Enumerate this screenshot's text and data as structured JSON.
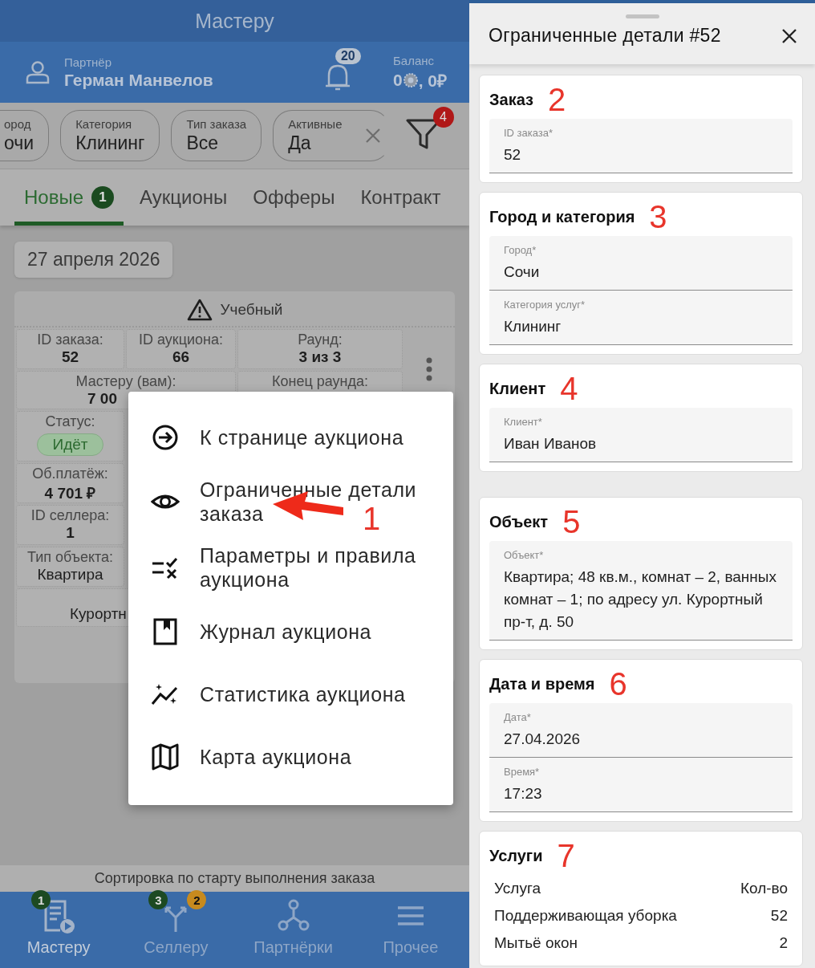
{
  "left_screen": {
    "title": "Мастеру",
    "partner": {
      "label": "Партнёр",
      "name": "Герман Манвелов"
    },
    "notifications": {
      "count": "20"
    },
    "balance": {
      "label": "Баланс",
      "coins": "0",
      "rubles": ", 0₽"
    },
    "filters": [
      {
        "label": "ород",
        "value": "очи",
        "clearable": false
      },
      {
        "label": "Категория",
        "value": "Клининг",
        "clearable": false
      },
      {
        "label": "Тип заказа",
        "value": "Все",
        "clearable": false
      },
      {
        "label": "Активные",
        "value": "Да",
        "clearable": true
      }
    ],
    "filter_button": {
      "badge": "4"
    },
    "tabs": [
      {
        "label": "Новые",
        "badge": "1",
        "selected": true
      },
      {
        "label": "Аукционы",
        "selected": false
      },
      {
        "label": "Офферы",
        "selected": false
      },
      {
        "label": "Контракт",
        "selected": false
      }
    ],
    "date": "27 апреля 2026",
    "card": {
      "banner": "Учебный",
      "fields": [
        {
          "kind": "plain",
          "label": "ID заказа:",
          "value": "52"
        },
        {
          "kind": "plain",
          "label": "ID аукциона:",
          "value": "66"
        },
        {
          "kind": "plain",
          "label": "Раунд:",
          "value": "3 из 3"
        },
        {
          "kind": "plain",
          "label": "Мастеру (вам):",
          "value": "7 00"
        },
        {
          "label": "Конец раунда:"
        },
        {
          "kind": "status",
          "label": "Статус:",
          "value": "Идёт"
        },
        {
          "kind": "plain",
          "label": "Об.платёж:",
          "value": "4 701 ₽"
        },
        {
          "kind": "plain",
          "label": "ID селлера:",
          "value": "1"
        },
        {
          "kind": "light",
          "label": "Тип объекта:",
          "value": "Квартира"
        },
        {
          "kind": "light",
          "value": "Курортн"
        }
      ]
    },
    "menu": [
      {
        "label": "К странице аукциона"
      },
      {
        "label": "Ограниченные детали заказа",
        "annotation": "1"
      },
      {
        "label": "Параметры и правила аукциона"
      },
      {
        "label": "Журнал аукциона"
      },
      {
        "label": "Статистика аукциона"
      },
      {
        "label": "Карта аукциона"
      }
    ],
    "sort_label": "Сортировка по старту выполнения заказа",
    "bottom_nav": [
      {
        "label": "Мастеру",
        "selected": true,
        "badges": [
          {
            "text": "1",
            "color": "#1d4a22"
          }
        ]
      },
      {
        "label": "Селлеру",
        "selected": false,
        "badges": [
          {
            "text": "3",
            "color": "#1d4a22"
          },
          {
            "text": "2",
            "color": "#c78a1e"
          }
        ]
      },
      {
        "label": "Партнёрки",
        "selected": false
      },
      {
        "label": "Прочее",
        "selected": false
      }
    ]
  },
  "details_sheet": {
    "title": "Ограниченные детали #52",
    "sections": [
      {
        "kind": "fields",
        "title": "Заказ",
        "annotation": "2",
        "fields": [
          {
            "label": "ID заказа*",
            "value": "52"
          }
        ]
      },
      {
        "kind": "fields",
        "title": "Город и категория",
        "annotation": "3",
        "fields": [
          {
            "label": "Город*",
            "value": "Сочи"
          },
          {
            "label": "Категория услуг*",
            "value": "Клининг"
          }
        ]
      },
      {
        "kind": "fields",
        "title": "Клиент",
        "annotation": "4",
        "fields": [
          {
            "label": "Клиент*",
            "value": "Иван Иванов"
          }
        ]
      },
      {
        "kind": "fields",
        "title": "Объект",
        "annotation": "5",
        "fields": [
          {
            "label": "Объект*",
            "value": "Квартира; 48 кв.м., комнат – 2, ванных комнат – 1; по адресу ул. Курортный пр-т, д. 50"
          }
        ]
      },
      {
        "kind": "fields",
        "title": "Дата и время",
        "annotation": "6",
        "fields": [
          {
            "label": "Дата*",
            "value": "27.04.2026"
          },
          {
            "label": "Время*",
            "value": "17:23"
          }
        ]
      },
      {
        "kind": "table",
        "title": "Услуги",
        "annotation": "7",
        "columns": [
          "Услуга",
          "Кол-во"
        ],
        "rows": [
          [
            "Поддерживающая уборка",
            "52"
          ],
          [
            "Мытьё окон",
            "2"
          ]
        ]
      }
    ]
  }
}
